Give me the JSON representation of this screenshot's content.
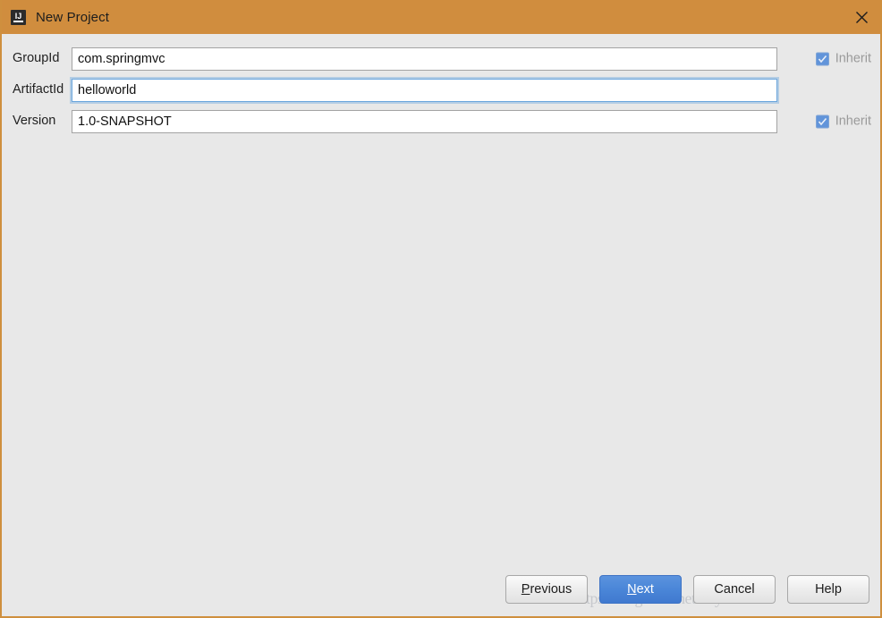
{
  "window": {
    "title": "New Project",
    "app_icon": "intellij-idea-icon",
    "icon_text": "IJ",
    "close_icon": "close-icon",
    "titlebar_color": "#d08d3e",
    "background_color": "#e8e8e8"
  },
  "form": {
    "fields": [
      {
        "label": "GroupId",
        "value": "com.springmvc",
        "placeholder": "",
        "focused": false,
        "inherit": {
          "label": "Inherit",
          "checked": true,
          "enabled": false
        }
      },
      {
        "label": "ArtifactId",
        "value": "helloworld",
        "placeholder": "",
        "focused": true,
        "inherit": null
      },
      {
        "label": "Version",
        "value": "1.0-SNAPSHOT",
        "placeholder": "",
        "focused": false,
        "inherit": {
          "label": "Inherit",
          "checked": true,
          "enabled": false
        }
      }
    ]
  },
  "footer": {
    "buttons": [
      {
        "label": "Previous",
        "mnemonic": "P",
        "primary": false
      },
      {
        "label": "Next",
        "mnemonic": "N",
        "primary": true
      },
      {
        "label": "Cancel",
        "mnemonic": "",
        "primary": false
      },
      {
        "label": "Help",
        "mnemonic": "",
        "primary": false
      }
    ]
  },
  "watermark": {
    "text": "https://blog.csdn.net/x2ya4a3B3"
  }
}
